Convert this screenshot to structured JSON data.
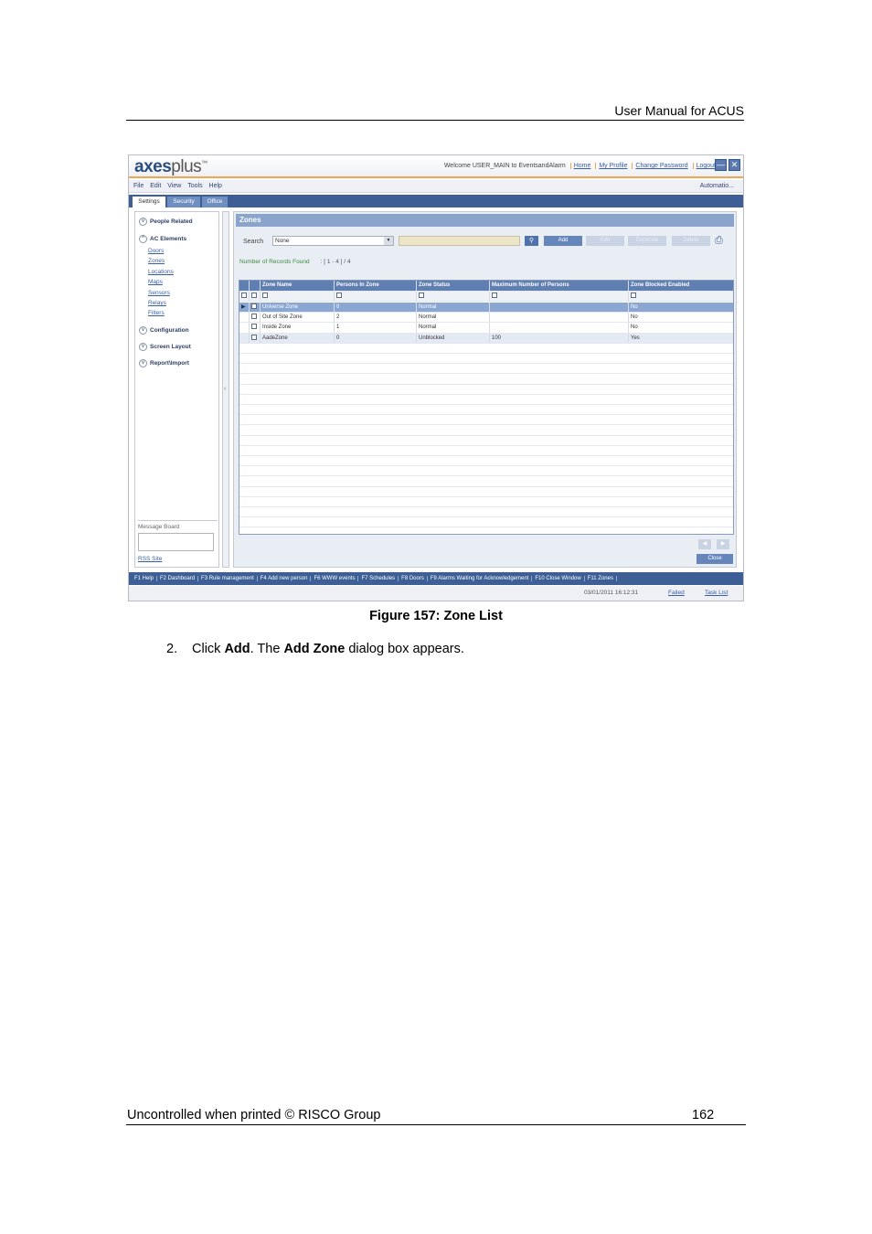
{
  "header": {
    "title": "User Manual for ACUS"
  },
  "app": {
    "logo_main": "axes",
    "logo_sub": "plus",
    "logo_tm": "™",
    "welcome": "Welcome USER_MAIN to EventsandAlarm",
    "links": [
      "Home",
      "My Profile",
      "Change Password",
      "Logout"
    ],
    "menu": [
      "File",
      "Edit",
      "View",
      "Tools",
      "Help"
    ],
    "automation": "Automatio...",
    "tabs": [
      "Settings",
      "Security",
      "Office"
    ]
  },
  "sidebar": {
    "people_related": "People Related",
    "ac_elements": "AC Elements",
    "ac_items": [
      "Doors",
      "Zones",
      "Locations",
      "Maps",
      "Sensors",
      "Relays",
      "Filters"
    ],
    "configuration": "Configuration",
    "screen_layout": "Screen Layout",
    "report_import": "Report\\Import",
    "message_board": "Message Board",
    "rss": "RSS Site"
  },
  "zones": {
    "title": "Zones",
    "search_label": "Search",
    "search_value": "None",
    "buttons": [
      "Add",
      "Edit",
      "Duplicate",
      "Delete"
    ],
    "records_label": "Number of Records Found",
    "records_range": ": [ 1 - 4 ] / 4",
    "columns": [
      "Zone Name",
      "Persons In Zone",
      "Zone Status",
      "Maximum Number of Persons",
      "Zone Blocked Enabled"
    ],
    "rows": [
      {
        "name": "Universe Zone",
        "persons": "0",
        "status": "Normal",
        "max": "",
        "blocked": "No"
      },
      {
        "name": "Out of Site Zone",
        "persons": "2",
        "status": "Normal",
        "max": "",
        "blocked": "No"
      },
      {
        "name": "Inside Zone",
        "persons": "1",
        "status": "Normal",
        "max": "",
        "blocked": "No"
      },
      {
        "name": "AadeZone",
        "persons": "0",
        "status": "Unblocked",
        "max": "100",
        "blocked": "Yes"
      }
    ],
    "close": "Close"
  },
  "fkeys": [
    "F1 Help",
    "F2 Dashboard",
    "F3 Rule management",
    "F4 Add new person",
    "F6 WWW events",
    "F7 Schedules",
    "F8 Doors",
    "F9 Alarms Waiting for Acknowledgement",
    "F10 Close Window",
    "F11 Zones"
  ],
  "status": {
    "timestamp": "03/01/2011 16:12:31",
    "failed": "Failed",
    "tasklist": "Task List"
  },
  "caption": "Figure 157: Zone List",
  "step": {
    "num": "2.",
    "pre": "Click ",
    "b1": "Add",
    "mid": ". The ",
    "b2": "Add Zone",
    "post": " dialog box appears."
  },
  "footer": {
    "left": "Uncontrolled when printed © RISCO Group",
    "page": "162"
  }
}
